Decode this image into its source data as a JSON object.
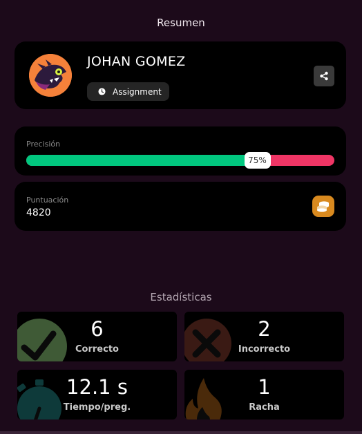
{
  "summary": {
    "title": "Resumen"
  },
  "player": {
    "name": "JOHAN GOMEZ",
    "mode_label": "Assignment",
    "avatar_icon": "bird-avatar-icon",
    "share_icon": "share-icon"
  },
  "accuracy": {
    "label": "Precisión",
    "percent_text": "75%",
    "fraction": 0.75,
    "correct_color": "#01c77f",
    "incorrect_color": "#ef3565"
  },
  "score": {
    "label": "Puntuación",
    "value": "4820",
    "icon": "coins-icon"
  },
  "statistics": {
    "title": "Estadísticas",
    "items": [
      {
        "value": "6",
        "label": "Correcto",
        "icon": "checkmark-icon",
        "color": "#3f5a36"
      },
      {
        "value": "2",
        "label": "Incorrecto",
        "icon": "cross-icon",
        "color": "#3a1a14"
      },
      {
        "value": "12.1 s",
        "label": "Tiempo/preg.",
        "icon": "stopwatch-icon",
        "color": "#0e3a3a"
      },
      {
        "value": "1",
        "label": "Racha",
        "icon": "flame-icon",
        "color": "#4a2a0a"
      }
    ]
  }
}
